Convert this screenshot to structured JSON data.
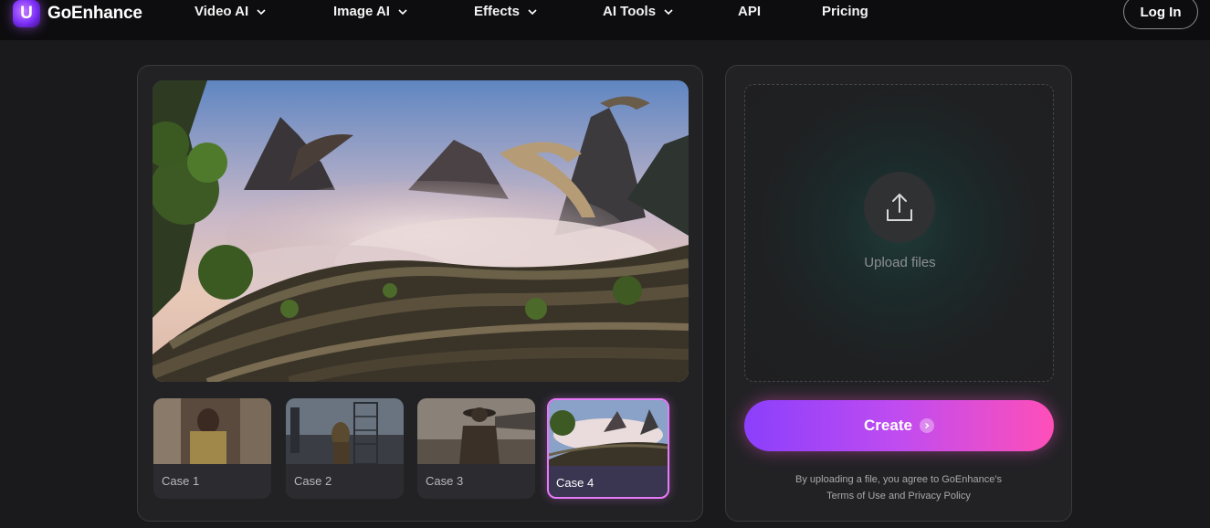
{
  "brand": {
    "name": "GoEnhance",
    "mark": "U"
  },
  "nav": {
    "items": [
      {
        "label": "Video AI",
        "dropdown": true
      },
      {
        "label": "Image AI",
        "dropdown": true
      },
      {
        "label": "Effects",
        "dropdown": true
      },
      {
        "label": "AI Tools",
        "dropdown": true
      },
      {
        "label": "API",
        "dropdown": false
      },
      {
        "label": "Pricing",
        "dropdown": false
      }
    ],
    "login_label": "Log In"
  },
  "cases": [
    {
      "label": "Case 1",
      "active": false
    },
    {
      "label": "Case 2",
      "active": false
    },
    {
      "label": "Case 3",
      "active": false
    },
    {
      "label": "Case 4",
      "active": true
    }
  ],
  "upload": {
    "label": "Upload files",
    "icon": "upload-icon"
  },
  "create": {
    "label": "Create"
  },
  "terms": {
    "line1": "By uploading a file, you agree to GoEnhance's",
    "terms_link": "Terms of Use",
    "and": "and",
    "privacy_link": "Privacy Policy"
  },
  "colors": {
    "accent_start": "#8b3ffc",
    "accent_end": "#ff4fb8",
    "active_case_border": "#e879f9",
    "nav_bg": "#0d0d0f",
    "page_bg": "#1a1a1c"
  }
}
